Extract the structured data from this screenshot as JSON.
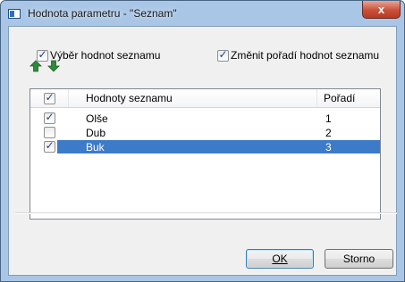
{
  "window": {
    "title": "Hodnota parametru - \"Seznam\"",
    "close_label": "x"
  },
  "options": {
    "select_values_label": "Výběr hodnot seznamu",
    "select_values_checked": true,
    "reorder_label": "Změnit pořadí hodnot seznamu",
    "reorder_checked": true
  },
  "toolbar": {
    "move_up_icon": "arrow-up-icon",
    "move_down_icon": "arrow-down-icon"
  },
  "list": {
    "headers": {
      "check_all_checked": true,
      "values": "Hodnoty seznamu",
      "order": "Pořadí"
    },
    "rows": [
      {
        "checked": true,
        "value": "Olše",
        "order": "1",
        "selected": false
      },
      {
        "checked": false,
        "value": "Dub",
        "order": "2",
        "selected": false
      },
      {
        "checked": true,
        "value": "Buk",
        "order": "3",
        "selected": true
      }
    ]
  },
  "buttons": {
    "ok_label": "OK",
    "cancel_label": "Storno"
  },
  "colors": {
    "selection": "#3d7bc9",
    "arrow_green": "#2e8b3a",
    "close_red": "#c9503a"
  }
}
